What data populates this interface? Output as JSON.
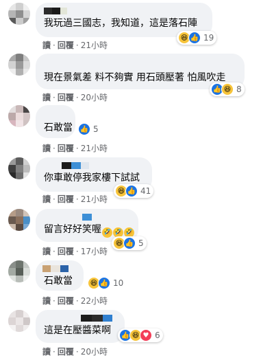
{
  "comments": [
    {
      "text": "我玩過三國志，我知道，這是落石陣",
      "reaction_count": "19",
      "reply": "回覆",
      "read": "讀",
      "time": "21小時"
    },
    {
      "text": "現在景氣差 料不夠實 用石頭壓著 怕風吹走",
      "reaction_count": "8",
      "reply": "回覆",
      "read": "讀",
      "time": "20小時"
    },
    {
      "text": "石敢當",
      "reaction_count": "5",
      "reply": "回覆",
      "read": "讀",
      "time": "21小時"
    },
    {
      "text": "你車敢停我家樓下試試",
      "reaction_count": "41",
      "reply": "回覆",
      "read": "讀",
      "time": "21小時"
    },
    {
      "text": "留言好好笑喔",
      "reaction_count": "5",
      "reply": "回覆",
      "read": "讀",
      "time": "17小時"
    },
    {
      "text": "石敢當",
      "reaction_count": "10",
      "reply": "回覆",
      "read": "讀",
      "time": "22小時"
    },
    {
      "text": "這是在壓醬菜啊",
      "reaction_count": "6",
      "reply": "回覆",
      "read": "讀",
      "time": "20小時"
    }
  ],
  "colors": {
    "bubble": "#f0f2f5",
    "meta": "#65676b",
    "like": "#1b74e4",
    "haha": "#f7c43a",
    "love": "#f33e58"
  },
  "icons": [
    "haha-icon",
    "like-icon",
    "love-icon",
    "wow-icon"
  ]
}
